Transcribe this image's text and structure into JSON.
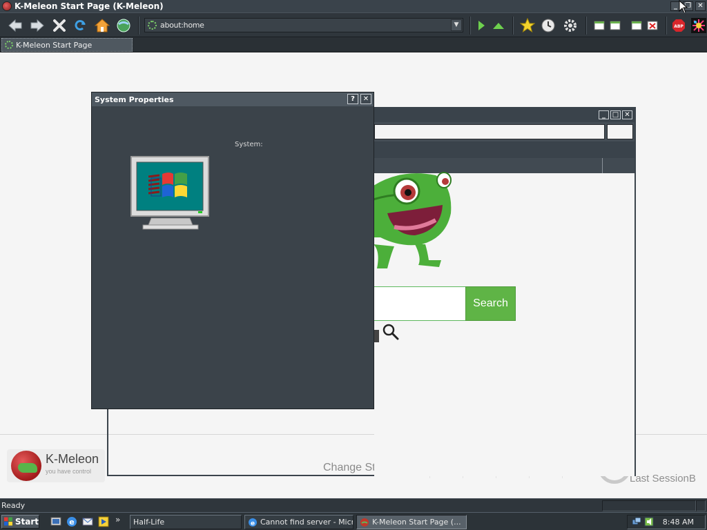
{
  "window": {
    "title": "K-Meleon Start Page (K-Meleon)",
    "minimize_label": "_",
    "restore_label": "❐",
    "close_label": "✕"
  },
  "toolbar": {
    "url": "about:home",
    "buttons": [
      "back-icon",
      "forward-icon",
      "stop-icon",
      "reload-icon",
      "home-icon",
      "globe-icon",
      "go-icon",
      "up-icon",
      "bookmark-star-icon",
      "history-clock-icon",
      "settings-gear-icon",
      "window-icon-1",
      "window-icon-2",
      "window-icon-3",
      "close-window-icon",
      "adblock-icon",
      "kaleidoscope-icon"
    ]
  },
  "tabs": [
    {
      "label": "K-Meleon Start Page"
    }
  ],
  "page": {
    "search_button": "Search",
    "logo_title": "K-Meleon",
    "logo_subtitle": "you have control",
    "change_style": "Change Style",
    "last_session": "Last SessionB",
    "speed_dial_icons": [
      "new-window-icon",
      "clock-icon",
      "heart-icon",
      "download-icon",
      "tools-icon",
      "trash-icon"
    ]
  },
  "dialog": {
    "title": "System Properties",
    "help_label": "?",
    "close_label": "✕",
    "system_label": "System:"
  },
  "status": {
    "text": "Ready"
  },
  "taskbar": {
    "start_label": "Start",
    "quick_launch_more": "»",
    "items": [
      {
        "label": "Half-Life"
      },
      {
        "label": "Cannot find server - Micr..."
      },
      {
        "label": "K-Meleon Start Page (..."
      }
    ],
    "clock": "8:48 AM"
  },
  "colors": {
    "chrome_dark": "#2f363c",
    "search_green": "#5fb446",
    "dialog_bg": "#3b434a"
  }
}
